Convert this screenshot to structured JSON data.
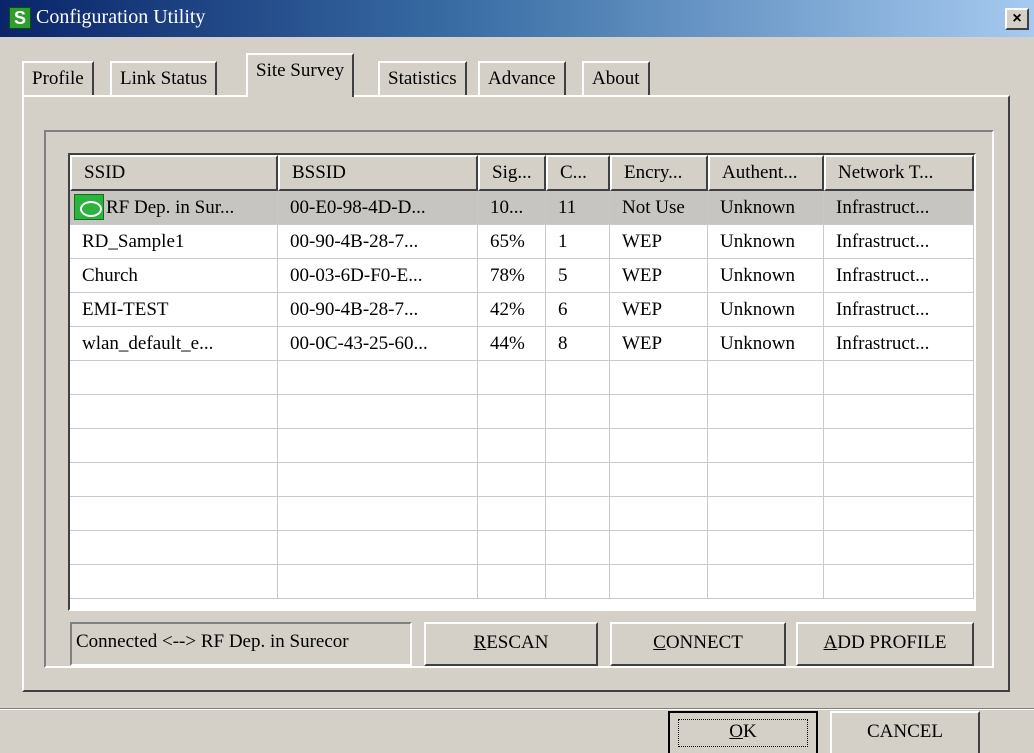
{
  "window": {
    "title": "Configuration Utility",
    "icon": "app-logo-icon",
    "close_glyph": "×"
  },
  "tabs": [
    {
      "label": "Profile"
    },
    {
      "label": "Link Status"
    },
    {
      "label": "Site Survey",
      "active": true
    },
    {
      "label": "Statistics"
    },
    {
      "label": "Advance"
    },
    {
      "label": "About"
    }
  ],
  "table": {
    "columns": [
      "SSID",
      "BSSID",
      "Sig...",
      "C...",
      "Encry...",
      "Authent...",
      "Network T..."
    ],
    "rows": [
      {
        "ssid": "RF Dep. in Sur...",
        "bssid": "00-E0-98-4D-D...",
        "signal": "10...",
        "channel": "11",
        "encryption": "Not Use",
        "auth": "Unknown",
        "network": "Infrastruct...",
        "selected": true,
        "icon": "connected-network-icon"
      },
      {
        "ssid": "RD_Sample1",
        "bssid": "00-90-4B-28-7...",
        "signal": "65%",
        "channel": "1",
        "encryption": "WEP",
        "auth": "Unknown",
        "network": "Infrastruct..."
      },
      {
        "ssid": "Church",
        "bssid": "00-03-6D-F0-E...",
        "signal": "78%",
        "channel": "5",
        "encryption": "WEP",
        "auth": "Unknown",
        "network": "Infrastruct..."
      },
      {
        "ssid": "EMI-TEST",
        "bssid": "00-90-4B-28-7...",
        "signal": "42%",
        "channel": "6",
        "encryption": "WEP",
        "auth": "Unknown",
        "network": "Infrastruct..."
      },
      {
        "ssid": "wlan_default_e...",
        "bssid": "00-0C-43-25-60...",
        "signal": "44%",
        "channel": "8",
        "encryption": "WEP",
        "auth": "Unknown",
        "network": "Infrastruct..."
      }
    ],
    "empty_rows": 7
  },
  "status": {
    "text": "Connected <--> RF Dep. in Surecor"
  },
  "buttons": {
    "rescan": {
      "mnemonic": "R",
      "rest": "ESCAN"
    },
    "connect": {
      "mnemonic": "C",
      "rest": "ONNECT"
    },
    "add_profile": {
      "mnemonic": "A",
      "rest": "DD PROFILE"
    },
    "ok": {
      "mnemonic": "O",
      "rest": "K"
    },
    "cancel": {
      "label": "CANCEL"
    }
  }
}
